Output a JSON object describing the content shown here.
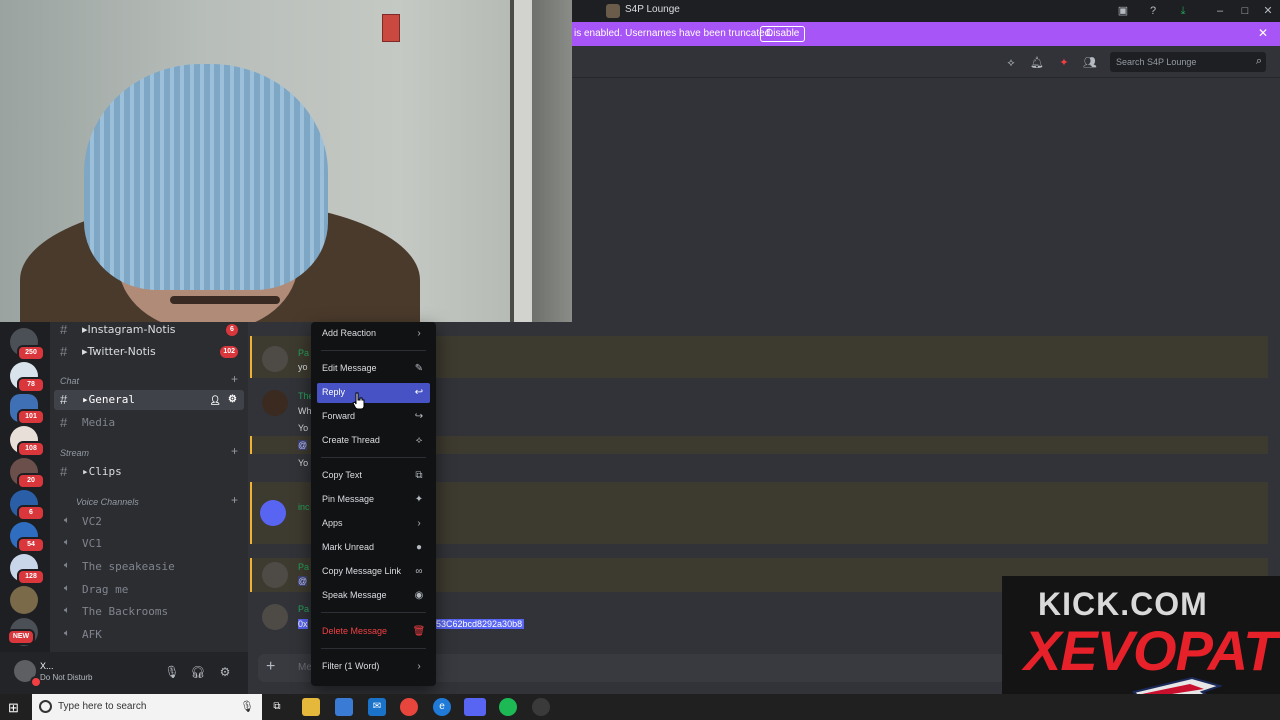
{
  "window": {
    "title": "S4P Lounge"
  },
  "notice": {
    "text": "is enabled. Usernames have been truncated.",
    "button": "Disable"
  },
  "header": {
    "search_placeholder": "Search S4P Lounge"
  },
  "servers": {
    "badges": [
      "250",
      "78",
      "101",
      "108",
      "20",
      "6",
      "54",
      "128"
    ],
    "new_badge": "NEW"
  },
  "channels": {
    "items": [
      {
        "label": "▸Instagram-Notis",
        "badge": "6"
      },
      {
        "label": "▸Twitter-Notis",
        "badge": "102"
      },
      {
        "label": "▸General"
      },
      {
        "label": "Media"
      },
      {
        "label": "▸Clips"
      }
    ],
    "categories": {
      "chat": "Chat",
      "stream": "Stream",
      "voice": "Voice Channels"
    },
    "voice": [
      "VC2",
      "VC1",
      "The speakeasie",
      "Drag me",
      "The Backrooms",
      "AFK"
    ]
  },
  "user": {
    "name": "X...",
    "status": "Do Not Disturb"
  },
  "messages": {
    "fragments": [
      "Pa",
      "yo",
      "The",
      "Wh",
      "Yo",
      "@",
      "Yo",
      "inc",
      "Pa",
      "@",
      "Pa"
    ],
    "highlighted_start": "0x",
    "highlighted_rest": "53C62bcd8292a30b8"
  },
  "composer": {
    "placeholder": "Me"
  },
  "context_menu": {
    "items": [
      {
        "label": "Add Reaction",
        "icon": "chevron-right"
      },
      {
        "label": "Edit Message",
        "icon": "pencil"
      },
      {
        "label": "Reply",
        "icon": "reply"
      },
      {
        "label": "Forward",
        "icon": "forward"
      },
      {
        "label": "Create Thread",
        "icon": "thread"
      },
      {
        "label": "Copy Text",
        "icon": "copy"
      },
      {
        "label": "Pin Message",
        "icon": "pin"
      },
      {
        "label": "Apps",
        "icon": "chevron-right"
      },
      {
        "label": "Mark Unread",
        "icon": "bell-dot"
      },
      {
        "label": "Copy Message Link",
        "icon": "link"
      },
      {
        "label": "Speak Message",
        "icon": "speaker"
      },
      {
        "label": "Delete Message",
        "icon": "trash"
      },
      {
        "label": "Filter (1 Word)",
        "icon": "chevron-right"
      }
    ]
  },
  "overlay": {
    "line1": "KICK.COM",
    "line2": "XEVOPAT"
  },
  "taskbar": {
    "search_placeholder": "Type here to search"
  },
  "colors": {
    "accent": "#5865f2",
    "notice": "#a855f7",
    "danger": "#f23f43",
    "kick_red": "#e6212a"
  }
}
